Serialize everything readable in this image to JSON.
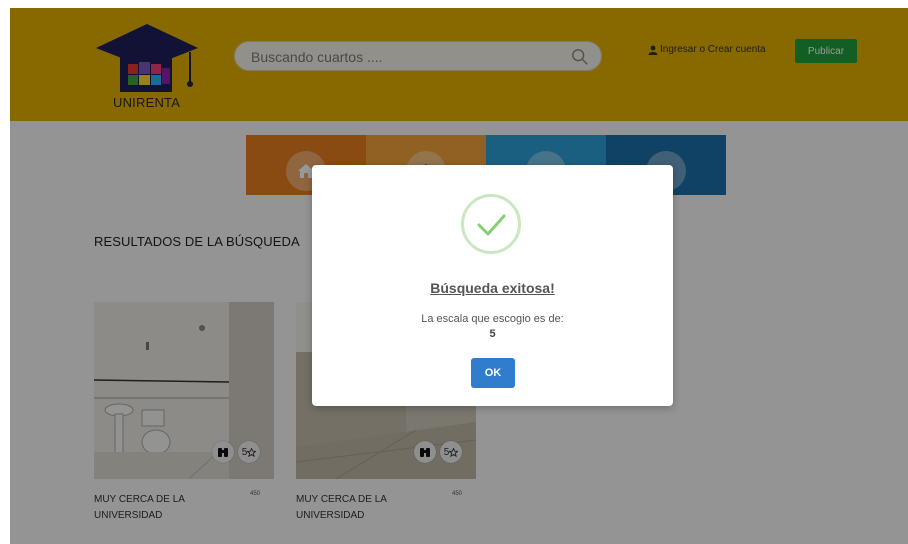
{
  "header": {
    "logo_text": "UNIRENTA",
    "search_placeholder": "Buscando cuartos ....",
    "login_label": "Ingresar o Crear cuenta",
    "publish_label": "Publicar"
  },
  "categories": [
    {
      "icon": "house-icon",
      "color": "#e77d1e"
    },
    {
      "icon": "building-icon",
      "color": "#f0a23a"
    },
    {
      "icon": "room-icon",
      "color": "#2e9fd6"
    },
    {
      "icon": "bed-icon",
      "color": "#1c6ea8"
    }
  ],
  "results": {
    "title": "RESULTADOS DE LA BÚSQUEDA",
    "cards": [
      {
        "title": "MUY CERCA DE LA UNIVERSIDAD",
        "price": "450",
        "rating_label": "5"
      },
      {
        "title": "MUY CERCA DE LA UNIVERSIDAD",
        "price": "450",
        "rating_label": "5"
      }
    ]
  },
  "modal": {
    "title": "Búsqueda exitosa!",
    "text": "La escala que escogio es de:",
    "value": "5",
    "ok_label": "OK"
  },
  "colors": {
    "header_bg": "#e3b000",
    "publish_green": "#1e9e3d",
    "ok_blue": "#2f7dcc",
    "success_green": "#86cf74"
  }
}
